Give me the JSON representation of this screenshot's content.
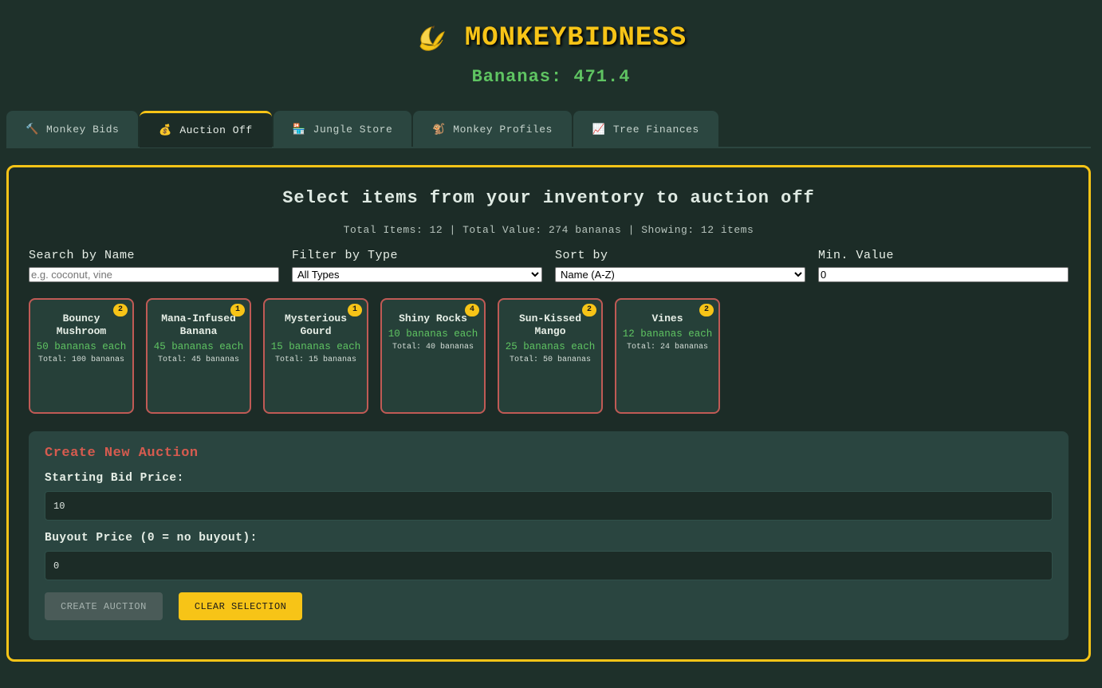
{
  "header": {
    "title": "MONKEYBIDNESS",
    "bananas_label": "Bananas: 471.4"
  },
  "tabs": [
    {
      "label": "Monkey Bids",
      "icon": "🔨"
    },
    {
      "label": "Auction Off",
      "icon": "💰"
    },
    {
      "label": "Jungle Store",
      "icon": "🏪"
    },
    {
      "label": "Monkey Profiles",
      "icon": "🐒"
    },
    {
      "label": "Tree Finances",
      "icon": "📈"
    }
  ],
  "panel": {
    "title": "Select items from your inventory to auction off",
    "stats": "Total Items: 12 | Total Value: 274 bananas | Showing: 12 items"
  },
  "filters": {
    "search_label": "Search by Name",
    "search_placeholder": "e.g. coconut, vine",
    "search_value": "",
    "type_label": "Filter by Type",
    "type_value": "All Types",
    "sort_label": "Sort by",
    "sort_value": "Name (A-Z)",
    "min_label": "Min. Value",
    "min_value": "0"
  },
  "items": [
    {
      "name": "Bouncy Mushroom",
      "qty": "2",
      "price": "50 bananas each",
      "total": "Total: 100 bananas"
    },
    {
      "name": "Mana-Infused Banana",
      "qty": "1",
      "price": "45 bananas each",
      "total": "Total: 45 bananas"
    },
    {
      "name": "Mysterious Gourd",
      "qty": "1",
      "price": "15 bananas each",
      "total": "Total: 15 bananas"
    },
    {
      "name": "Shiny Rocks",
      "qty": "4",
      "price": "10 bananas each",
      "total": "Total: 40 bananas"
    },
    {
      "name": "Sun-Kissed Mango",
      "qty": "2",
      "price": "25 bananas each",
      "total": "Total: 50 bananas"
    },
    {
      "name": "Vines",
      "qty": "2",
      "price": "12 bananas each",
      "total": "Total: 24 bananas"
    }
  ],
  "create": {
    "title": "Create New Auction",
    "start_label": "Starting Bid Price:",
    "start_value": "10",
    "buyout_label": "Buyout Price (0 = no buyout):",
    "buyout_value": "0",
    "create_button": "CREATE AUCTION",
    "clear_button": "CLEAR SELECTION"
  }
}
